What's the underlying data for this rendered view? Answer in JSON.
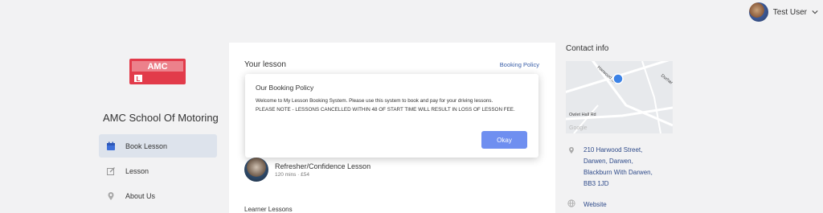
{
  "user": {
    "name": "Test User"
  },
  "school": {
    "name": "AMC School Of Motoring",
    "logo_text": "AMC"
  },
  "nav": {
    "items": [
      {
        "label": "Book Lesson",
        "icon": "calendar-icon",
        "active": true
      },
      {
        "label": "Lesson",
        "icon": "edit-icon",
        "active": false
      },
      {
        "label": "About Us",
        "icon": "location-pin-icon",
        "active": false
      }
    ]
  },
  "lesson_panel": {
    "title": "Your lesson",
    "policy_link": "Booking Policy",
    "lesson": {
      "title": "Refresher/Confidence Lesson",
      "meta": "120 mins · £54"
    },
    "learner_lessons_title": "Learner Lessons"
  },
  "modal": {
    "title": "Our Booking Policy",
    "body_line1": "Welcome to My Lesson Booking System. Please use this system to book and pay for your driving lessons.",
    "body_line2": "PLEASE NOTE - LESSONS CANCELLED WITHIN 48 OF START TIME WILL RESULT IN LOSS OF LESSON FEE.",
    "ok_label": "Okay"
  },
  "contact": {
    "title": "Contact info",
    "map_labels": {
      "street1": "Harwood St",
      "street2": "Durhar",
      "street3": "Owlet Hall Rd",
      "brand": "Google"
    },
    "address_lines": [
      "210 Harwood Street,",
      "Darwen, Darwen,",
      "Blackburn With Darwen,",
      "BB3 1JD"
    ],
    "website_label": "Website"
  },
  "colors": {
    "accent": "#6f8ff0",
    "link": "#2f4b8a",
    "nav_active": "#dde3ec",
    "logo_red": "#e23b4a"
  }
}
